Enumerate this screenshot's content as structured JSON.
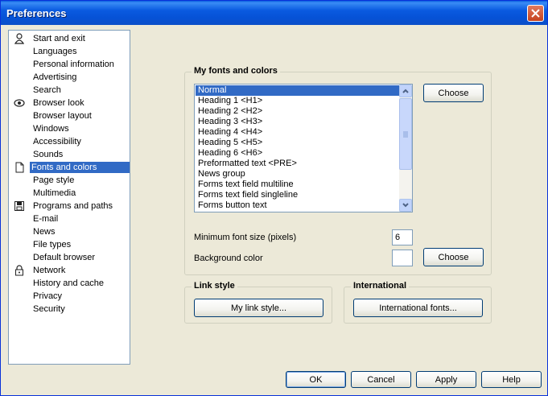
{
  "window": {
    "title": "Preferences"
  },
  "nav": {
    "items": [
      {
        "label": "Start and exit",
        "icon": "person-icon"
      },
      {
        "label": "Languages"
      },
      {
        "label": "Personal information"
      },
      {
        "label": "Advertising"
      },
      {
        "label": "Search"
      },
      {
        "label": "Browser look",
        "icon": "eye-icon"
      },
      {
        "label": "Browser layout"
      },
      {
        "label": "Windows"
      },
      {
        "label": "Accessibility"
      },
      {
        "label": "Sounds"
      },
      {
        "label": "Fonts and colors",
        "icon": "document-icon",
        "selected": true
      },
      {
        "label": "Page style"
      },
      {
        "label": "Multimedia"
      },
      {
        "label": "Programs and paths",
        "icon": "floppy-disk-icon"
      },
      {
        "label": "E-mail"
      },
      {
        "label": "News"
      },
      {
        "label": "File types"
      },
      {
        "label": "Default browser"
      },
      {
        "label": "Network",
        "icon": "lock-icon"
      },
      {
        "label": "History and cache"
      },
      {
        "label": "Privacy"
      },
      {
        "label": "Security"
      }
    ]
  },
  "fonts_group": {
    "title": "My fonts and colors",
    "list_items": [
      "Normal",
      "Heading 1 <H1>",
      "Heading 2 <H2>",
      "Heading 3 <H3>",
      "Heading 4 <H4>",
      "Heading 5 <H5>",
      "Heading 6 <H6>",
      "Preformatted text <PRE>",
      "News group",
      "Forms text field multiline",
      "Forms text field singleline",
      "Forms button text"
    ],
    "selected_index": 0,
    "choose_label": "Choose",
    "min_font_label": "Minimum font size (pixels)",
    "min_font_value": "6",
    "bg_color_label": "Background color",
    "bg_choose_label": "Choose"
  },
  "link_group": {
    "title": "Link style",
    "button_label": "My link style..."
  },
  "intl_group": {
    "title": "International",
    "button_label": "International fonts..."
  },
  "footer": {
    "ok": "OK",
    "cancel": "Cancel",
    "apply": "Apply",
    "help": "Help"
  },
  "colors": {
    "accent": "#316ac5",
    "title_bar": "#0a5ae0"
  }
}
